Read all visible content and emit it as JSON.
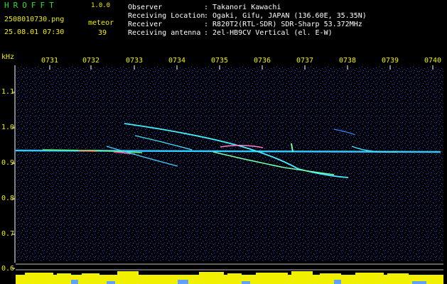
{
  "header": {
    "app_title": "HROFFT",
    "app_version": "1.0.0",
    "file_name": "2508010730.png",
    "date_time": "25.08.01 07:30",
    "meteor_label": "meteor",
    "meteor_count": "39"
  },
  "info": [
    {
      "label": "Observer",
      "value": ": Takanori Kawachi"
    },
    {
      "label": "Receiving Location",
      "value": ": Ogaki, Gifu, JAPAN (136.60E, 35.35N)"
    },
    {
      "label": "Receiver",
      "value": ": R820T2(RTL-SDR) SDR-Sharp 53.372MHz"
    },
    {
      "label": "Receiving antenna",
      "value": ": 2el-HB9CV Vertical (el. E-W)"
    }
  ],
  "axes": {
    "y_unit": "kHz",
    "x_ticks": [
      "0731",
      "0732",
      "0733",
      "0734",
      "0735",
      "0736",
      "0737",
      "0738",
      "0739",
      "0740"
    ],
    "y_ticks": [
      "1.1",
      "1.0",
      "0.9",
      "0.8",
      "0.7",
      "0.6"
    ]
  },
  "colors": {
    "background": "#000000",
    "noise_blue": "#1a2a9a",
    "carrier": "#40e0ff",
    "power_bar": "#f0f000",
    "label_yellow": "#f0f000",
    "label_green": "#30e030"
  }
}
